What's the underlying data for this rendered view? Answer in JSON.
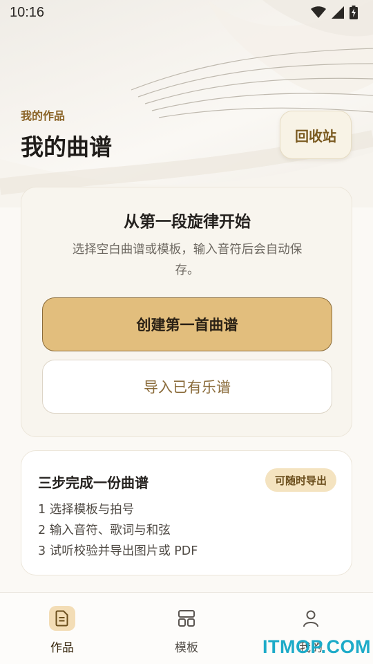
{
  "status_bar": {
    "time": "10:16",
    "icons": [
      "wifi-icon",
      "signal-icon",
      "battery-charging-icon"
    ]
  },
  "header": {
    "subtitle": "我的作品",
    "title": "我的曲谱",
    "recycle_label": "回收站"
  },
  "start_card": {
    "title": "从第一段旋律开始",
    "description_line1": "选择空白曲谱或模板，输入音符后会自动保",
    "description_line2": "存。",
    "create_label": "创建第一首曲谱",
    "import_label": "导入已有乐谱"
  },
  "steps_card": {
    "title": "三步完成一份曲谱",
    "badge": "可随时导出",
    "steps": [
      "1  选择模板与拍号",
      "2  输入音符、歌词与和弦",
      "3  试听校验并导出图片或 PDF"
    ]
  },
  "tabbar": {
    "tabs": [
      {
        "label": "作品",
        "icon": "document-icon",
        "active": true
      },
      {
        "label": "模板",
        "icon": "layout-icon",
        "active": false
      },
      {
        "label": "我的",
        "icon": "person-icon",
        "active": false
      }
    ]
  },
  "watermark": "ITMOP.COM",
  "colors": {
    "accent": "#e2be7d",
    "accent_dark": "#8a6326",
    "background": "#fbf9f5"
  }
}
